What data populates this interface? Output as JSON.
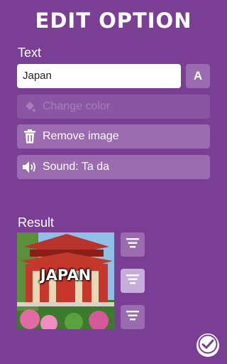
{
  "header": {
    "title": "EDIT OPTION"
  },
  "text_section": {
    "label": "Text",
    "value": "Japan",
    "font_button_label": "A"
  },
  "actions": {
    "change_color": "Change color",
    "remove_image": "Remove image",
    "sound": "Sound: Ta da"
  },
  "result": {
    "label": "Result",
    "caption": "JAPAN",
    "selected_alignment": "middle"
  },
  "colors": {
    "background": "#7a3f95",
    "button": "#9b6bb0",
    "active_button": "#c6addb"
  }
}
